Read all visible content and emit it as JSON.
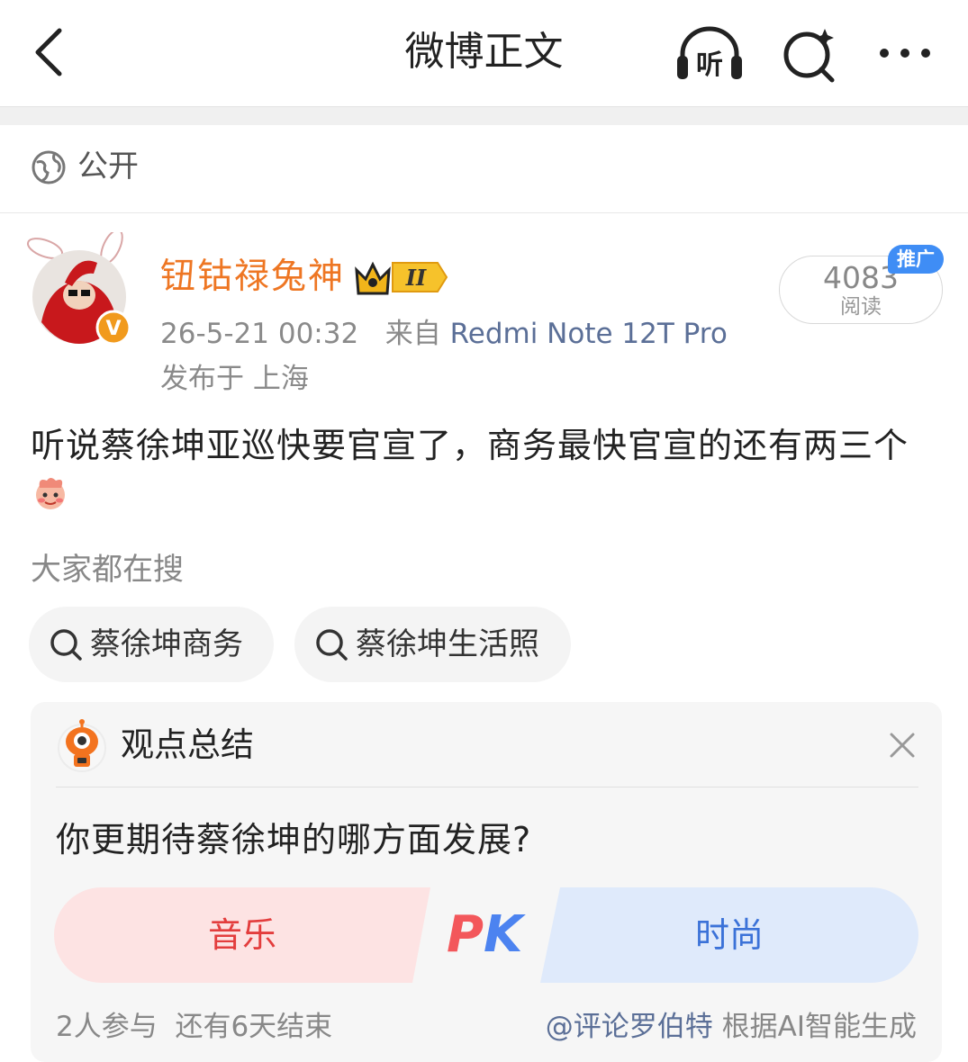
{
  "header": {
    "title": "微博正文",
    "listen_glyph": "听",
    "icons": [
      "back-arrow-icon",
      "listen-headphones-icon",
      "ai-search-icon",
      "more-dots-icon"
    ]
  },
  "visibility": {
    "label": "公开",
    "icon": "globe-icon"
  },
  "post": {
    "username": "钮钴禄兔神",
    "vip_level": "II",
    "time": "26-5-21 00:32",
    "from_prefix": "来自",
    "source": "Redmi Note 12T Pro",
    "location": "发布于 上海",
    "read_count": "4083",
    "read_label": "阅读",
    "promo_label": "推广",
    "text": "听说蔡徐坤亚巡快要官宣了，商务最快官宣的还有两三个",
    "verified_badge": "V",
    "accent_color": "#ee7623"
  },
  "search": {
    "label": "大家都在搜",
    "chips": [
      "蔡徐坤商务",
      "蔡徐坤生活照"
    ]
  },
  "summary": {
    "title": "观点总结",
    "question": "你更期待蔡徐坤的哪方面发展?",
    "option_a": "音乐",
    "option_b": "时尚",
    "pk_p": "P",
    "pk_k": "K",
    "participants": "2人参与",
    "remaining": "还有6天结束",
    "credit_mention": "@评论罗伯特",
    "credit_text": "根据AI智能生成"
  }
}
